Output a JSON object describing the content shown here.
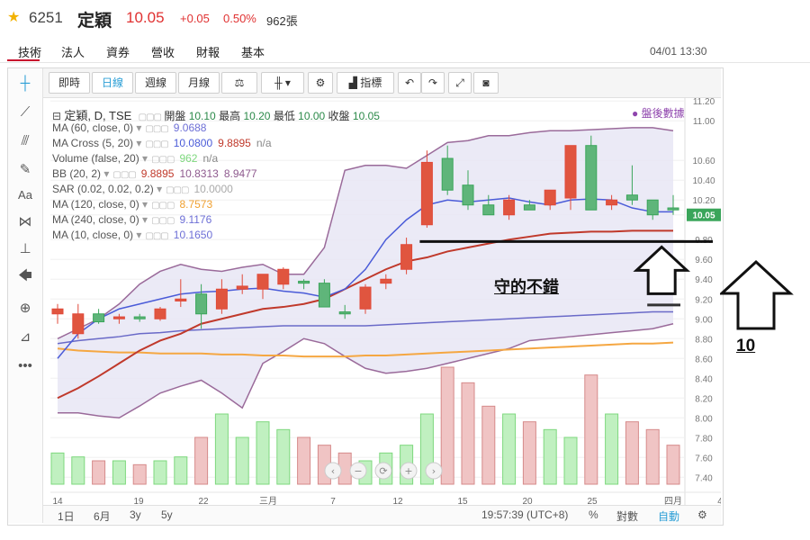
{
  "header": {
    "star": "★",
    "code": "6251",
    "name": "定穎",
    "price": "10.05",
    "change": "+0.05",
    "change_pct": "0.50%",
    "volume": "962張"
  },
  "tabs": [
    "技術",
    "法人",
    "資券",
    "營收",
    "財報",
    "基本"
  ],
  "datetime": "04/01 13:30",
  "toolbar": {
    "buttons": [
      "即時",
      "日線",
      "週線",
      "月線"
    ],
    "indicator_label": "指標"
  },
  "symbol_line": {
    "label": "定穎, D, TSE",
    "open_label": "開盤",
    "open": "10.10",
    "high_label": "最高",
    "high": "10.20",
    "low_label": "最低",
    "low": "10.00",
    "close_label": "收盤",
    "close": "10.05"
  },
  "indicators": [
    {
      "label": "MA (60, close, 0)",
      "values": [
        "9.0688"
      ],
      "colors": [
        "#6d6fd6"
      ]
    },
    {
      "label": "MA Cross (5, 20)",
      "values": [
        "10.0800",
        "9.8895",
        "n/a"
      ],
      "colors": [
        "#4a5bd8",
        "#c0392b",
        "#888888"
      ]
    },
    {
      "label": "Volume (false, 20)",
      "values": [
        "962",
        "n/a"
      ],
      "colors": [
        "#7ed87e",
        "#888888"
      ]
    },
    {
      "label": "BB (20, 2)",
      "values": [
        "9.8895",
        "10.8313",
        "8.9477"
      ],
      "colors": [
        "#c0392b",
        "#8e5a8e",
        "#8e5a8e"
      ]
    },
    {
      "label": "SAR (0.02, 0.02, 0.2)",
      "values": [
        "10.0000"
      ],
      "colors": [
        "#aaaaaa"
      ]
    },
    {
      "label": "MA (120, close, 0)",
      "values": [
        "8.7573"
      ],
      "colors": [
        "#f0a030"
      ]
    },
    {
      "label": "MA (240, close, 0)",
      "values": [
        "9.1176"
      ],
      "colors": [
        "#6d6fd6"
      ]
    },
    {
      "label": "MA (10, close, 0)",
      "values": [
        "10.1650"
      ],
      "colors": [
        "#6d6fd6"
      ]
    }
  ],
  "after_hours": "● 盤後數據",
  "annotation_text": "守的不錯",
  "annotation_10": "10",
  "bottom": {
    "ranges": [
      "1日",
      "6月",
      "3y",
      "5y"
    ],
    "clock": "19:57:39 (UTC+8)",
    "pct_label": "%",
    "log_label": "對數",
    "auto_label": "自動"
  },
  "chart_data": {
    "type": "candlestick",
    "x": [
      "14",
      "",
      "",
      "",
      "",
      "19",
      "",
      "",
      "",
      "22",
      "",
      "",
      "",
      "三月",
      "",
      "",
      "",
      "7",
      "",
      "",
      "",
      "12",
      "",
      "",
      "",
      "15",
      "",
      "",
      "",
      "20",
      "",
      "",
      "",
      "25",
      "",
      "",
      "",
      "",
      "",
      "四月"
    ],
    "x_ticks": [
      "14",
      "19",
      "22",
      "三月",
      "7",
      "12",
      "15",
      "20",
      "25",
      "四月",
      "4"
    ],
    "y_ticks": [
      "11.20",
      "11.00",
      "10.60",
      "10.40",
      "10.20",
      "10.05",
      "9.80",
      "9.60",
      "9.40",
      "9.20",
      "9.00",
      "8.80",
      "8.60",
      "8.40",
      "8.20",
      "8.00",
      "7.80",
      "7.60",
      "7.40"
    ],
    "ylim": [
      7.33,
      11.22
    ],
    "ohlc": [
      [
        9.05,
        9.15,
        8.95,
        9.1
      ],
      [
        8.85,
        9.15,
        8.8,
        9.05
      ],
      [
        9.05,
        9.1,
        8.95,
        8.97
      ],
      [
        9.0,
        9.05,
        8.95,
        9.02
      ],
      [
        9.02,
        9.05,
        8.97,
        9.0
      ],
      [
        9.0,
        9.12,
        8.98,
        9.1
      ],
      [
        9.18,
        9.4,
        9.12,
        9.2
      ],
      [
        9.25,
        9.35,
        8.9,
        9.05
      ],
      [
        9.1,
        9.4,
        9.05,
        9.3
      ],
      [
        9.3,
        9.45,
        9.25,
        9.33
      ],
      [
        9.3,
        9.45,
        9.2,
        9.45
      ],
      [
        9.35,
        9.52,
        9.3,
        9.5
      ],
      [
        9.38,
        9.4,
        9.3,
        9.36
      ],
      [
        9.36,
        9.4,
        9.15,
        9.12
      ],
      [
        9.07,
        9.14,
        9.0,
        9.05
      ],
      [
        9.1,
        9.35,
        9.05,
        9.32
      ],
      [
        9.36,
        9.45,
        9.3,
        9.4
      ],
      [
        9.5,
        9.82,
        9.45,
        9.75
      ],
      [
        9.95,
        10.7,
        9.92,
        10.58
      ],
      [
        10.62,
        10.75,
        10.25,
        10.3
      ],
      [
        10.35,
        10.5,
        10.1,
        10.15
      ],
      [
        10.15,
        10.25,
        10.1,
        10.05
      ],
      [
        10.05,
        10.25,
        10.0,
        10.2
      ],
      [
        10.15,
        10.2,
        10.12,
        10.1
      ],
      [
        10.15,
        10.25,
        10.1,
        10.3
      ],
      [
        10.22,
        10.4,
        10.1,
        10.75
      ],
      [
        10.75,
        10.85,
        10.15,
        10.1
      ],
      [
        10.15,
        10.25,
        10.1,
        10.2
      ],
      [
        10.25,
        10.55,
        10.15,
        10.2
      ],
      [
        10.2,
        10.2,
        10.0,
        10.05
      ],
      [
        10.12,
        10.25,
        10.05,
        10.1
      ]
    ],
    "bb_upper": [
      8.8,
      8.9,
      9.0,
      9.15,
      9.35,
      9.48,
      9.55,
      9.5,
      9.48,
      9.52,
      9.55,
      9.45,
      9.45,
      9.72,
      10.5,
      10.55,
      10.55,
      10.52,
      10.65,
      10.78,
      10.8,
      10.85,
      10.85,
      10.88,
      10.9,
      10.9,
      10.91,
      10.92,
      10.93,
      10.93,
      10.9
    ],
    "bb_mid": [
      8.4,
      8.62,
      8.82,
      8.95,
      9.08,
      9.15,
      9.2,
      9.22,
      9.25,
      9.3,
      9.32,
      9.22,
      9.25,
      9.35,
      9.55,
      9.65,
      9.72,
      9.75,
      9.78,
      9.8,
      9.82,
      9.85,
      9.86,
      9.87,
      9.88,
      9.88,
      9.89,
      9.89,
      9.89,
      9.89,
      9.89
    ],
    "bb_lower": [
      8.05,
      8.05,
      8.02,
      8.0,
      8.12,
      8.25,
      8.32,
      8.38,
      8.25,
      8.1,
      8.55,
      8.67,
      8.8,
      8.75,
      8.62,
      8.5,
      8.45,
      8.47,
      8.5,
      8.55,
      8.6,
      8.65,
      8.7,
      8.78,
      8.8,
      8.82,
      8.84,
      8.86,
      8.88,
      8.9,
      8.95
    ],
    "ma5": [
      8.6,
      8.85,
      9.0,
      9.1,
      9.15,
      9.2,
      9.25,
      9.27,
      9.28,
      9.3,
      9.31,
      9.28,
      9.26,
      9.22,
      9.3,
      9.5,
      9.8,
      10.0,
      10.15,
      10.2,
      10.18,
      10.2,
      10.22,
      10.18,
      10.15,
      10.2,
      10.21,
      10.2,
      10.12,
      10.08,
      10.08
    ],
    "ma20": [
      8.2,
      8.3,
      8.42,
      8.55,
      8.68,
      8.78,
      8.85,
      8.95,
      9.0,
      9.05,
      9.1,
      9.12,
      9.15,
      9.2,
      9.3,
      9.4,
      9.5,
      9.58,
      9.62,
      9.68,
      9.72,
      9.76,
      9.8,
      9.83,
      9.86,
      9.87,
      9.88,
      9.88,
      9.89,
      9.89,
      9.89
    ],
    "ma60": [
      8.75,
      8.78,
      8.8,
      8.82,
      8.85,
      8.86,
      8.88,
      8.89,
      8.9,
      8.91,
      8.92,
      8.93,
      8.93,
      8.93,
      8.93,
      8.93,
      8.94,
      8.95,
      8.96,
      8.97,
      8.98,
      8.99,
      9.0,
      9.01,
      9.02,
      9.03,
      9.04,
      9.05,
      9.06,
      9.07,
      9.07
    ],
    "ma120": [
      8.7,
      8.68,
      8.67,
      8.66,
      8.66,
      8.65,
      8.65,
      8.65,
      8.64,
      8.64,
      8.63,
      8.63,
      8.62,
      8.62,
      8.62,
      8.63,
      8.63,
      8.64,
      8.65,
      8.66,
      8.67,
      8.68,
      8.69,
      8.7,
      8.71,
      8.72,
      8.73,
      8.74,
      8.75,
      8.75,
      8.76
    ],
    "volumes": [
      40,
      35,
      30,
      30,
      25,
      30,
      35,
      60,
      90,
      60,
      80,
      70,
      60,
      50,
      40,
      30,
      40,
      50,
      90,
      150,
      130,
      100,
      90,
      80,
      70,
      60,
      140,
      90,
      80,
      70,
      50
    ],
    "volume_max": 1200,
    "support_level": 9.78
  }
}
